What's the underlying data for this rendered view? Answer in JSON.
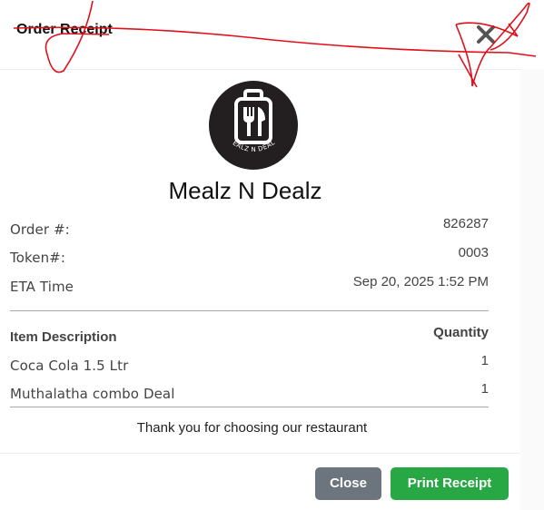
{
  "dialog": {
    "title": "Order Receipt"
  },
  "restaurant": {
    "name": "Mealz N Dealz",
    "logo_text": "MEALZ N DEALZ",
    "logo_icon": "fork-knife-bag-icon"
  },
  "order": {
    "rows": [
      {
        "label": "Order #:",
        "value": "826287"
      },
      {
        "label": "Token#:",
        "value": "0003"
      },
      {
        "label": "ETA Time",
        "value": "Sep 20, 2025 1:52 PM"
      }
    ]
  },
  "items": {
    "headers": {
      "description": "Item Description",
      "quantity": "Quantity"
    },
    "rows": [
      {
        "description": "Coca Cola 1.5 Ltr",
        "quantity": "1"
      },
      {
        "description": "Muthalatha combo Deal",
        "quantity": "1"
      }
    ]
  },
  "footer": {
    "thanks": "Thank you for choosing our restaurant",
    "close_label": "Close",
    "print_label": "Print Receipt"
  },
  "colors": {
    "close_button": "#6c757d",
    "print_button": "#28a745",
    "annotation": "#e0101a"
  }
}
